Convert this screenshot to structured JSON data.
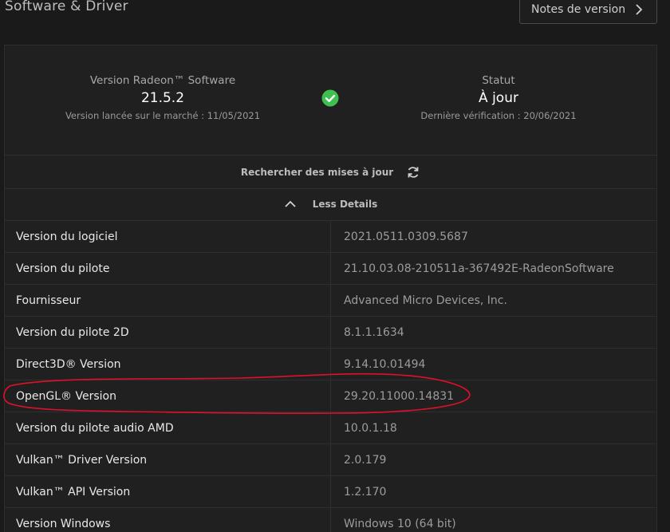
{
  "header": {
    "title": "Software & Driver",
    "release_notes_label": "Notes de version"
  },
  "summary": {
    "software": {
      "label": "Version Radeon™ Software",
      "value": "21.5.2",
      "sub": "Version lancée sur le marché : 11/05/2021"
    },
    "status": {
      "label": "Statut",
      "value": "À jour",
      "sub": "Dernière vérification : 20/06/2021"
    }
  },
  "actions": {
    "check_updates": "Rechercher des mises à jour",
    "less_details": "Less Details"
  },
  "details": [
    {
      "key": "Version du logiciel",
      "value": "2021.0511.0309.5687"
    },
    {
      "key": "Version du pilote",
      "value": "21.10.03.08-210511a-367492E-RadeonSoftware"
    },
    {
      "key": "Fournisseur",
      "value": "Advanced Micro Devices, Inc."
    },
    {
      "key": "Version du pilote 2D",
      "value": "8.1.1.1634"
    },
    {
      "key": "Direct3D® Version",
      "value": "9.14.10.01494"
    },
    {
      "key": "OpenGL® Version",
      "value": "29.20.11000.14831"
    },
    {
      "key": "Version du pilote audio AMD",
      "value": "10.0.1.18"
    },
    {
      "key": "Vulkan™ Driver Version",
      "value": "2.0.179"
    },
    {
      "key": "Vulkan™ API Version",
      "value": "1.2.170"
    },
    {
      "key": "Version Windows",
      "value": "Windows 10 (64 bit)"
    }
  ],
  "colors": {
    "background": "#1a1a1a",
    "panel": "#202020",
    "check_green": "#3fbf4f",
    "annotation_red": "#e0102a"
  }
}
